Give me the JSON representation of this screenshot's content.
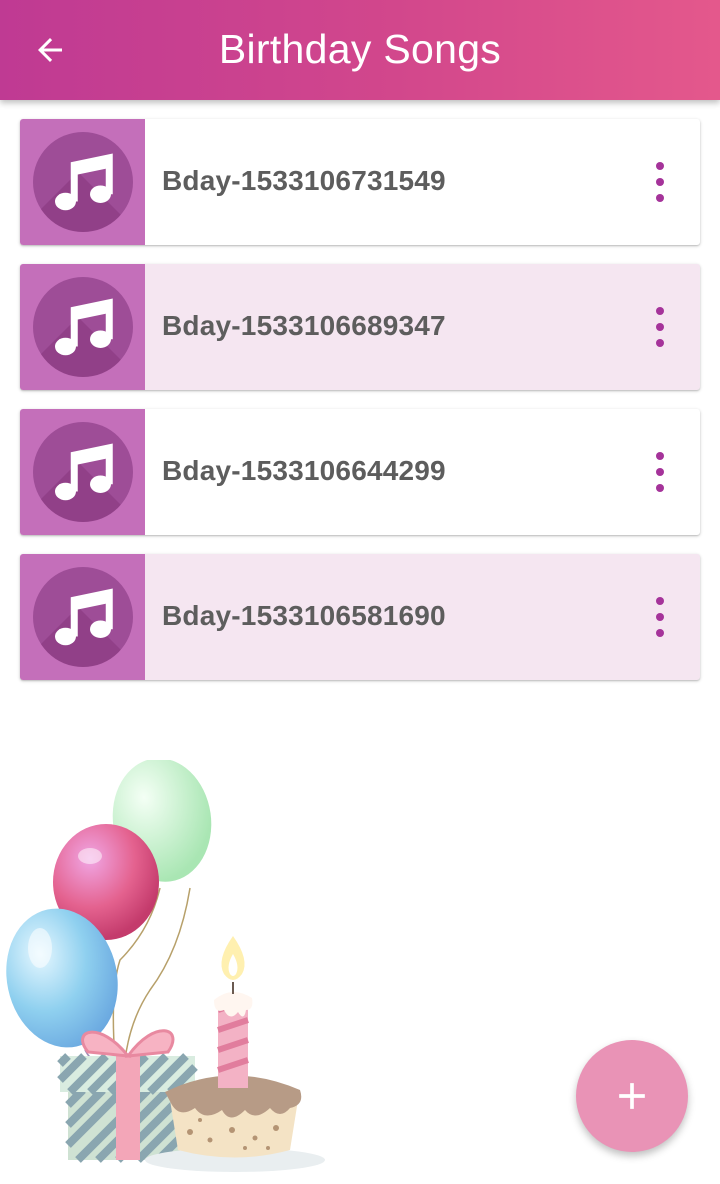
{
  "app_bar": {
    "title": "Birthday Songs",
    "back_icon": "arrow-left-icon",
    "gradient": [
      "#bf3a93",
      "#e4588c"
    ]
  },
  "songs": [
    {
      "title": "Bday-1533106731549",
      "icon": "music-note-icon",
      "menu_icon": "more-vert-icon"
    },
    {
      "title": "Bday-1533106689347",
      "icon": "music-note-icon",
      "menu_icon": "more-vert-icon"
    },
    {
      "title": "Bday-1533106644299",
      "icon": "music-note-icon",
      "menu_icon": "more-vert-icon"
    },
    {
      "title": "Bday-1533106581690",
      "icon": "music-note-icon",
      "menu_icon": "more-vert-icon"
    }
  ],
  "illustration": {
    "name": "balloons-cake-gift-illustration"
  },
  "fab": {
    "icon": "plus-icon",
    "color": "#e993b6"
  },
  "colors": {
    "accent": "#a5339a",
    "thumb_bg": "#c46fba",
    "alt_row_bg": "#f5e6f1"
  }
}
